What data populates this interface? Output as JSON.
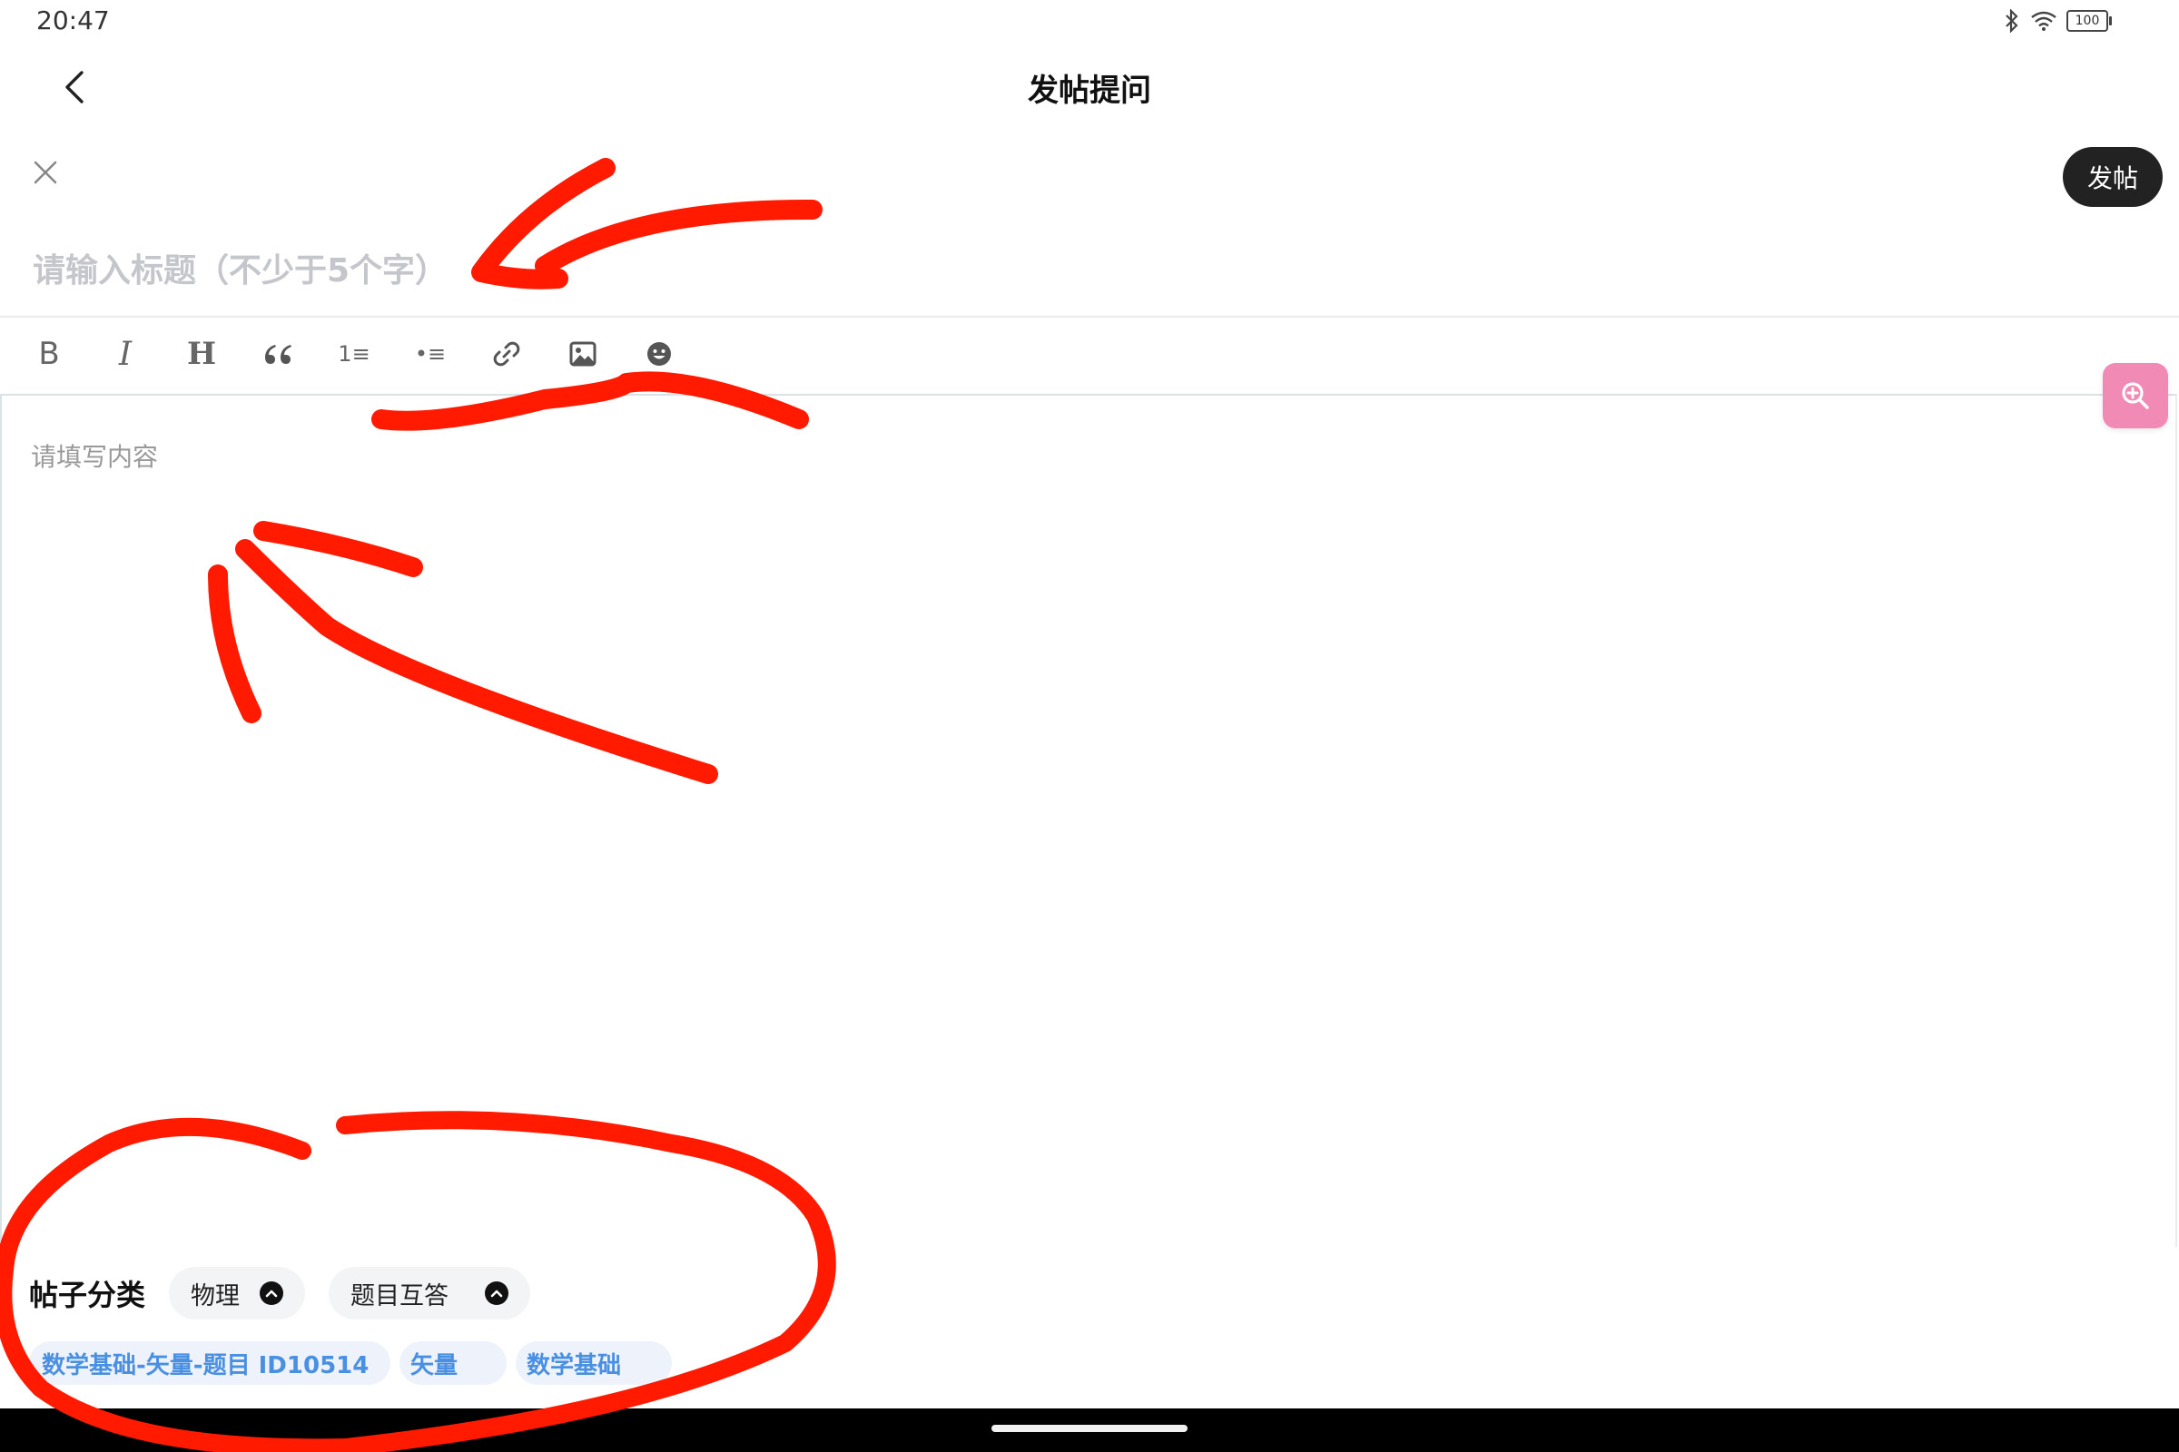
{
  "status_bar": {
    "time": "20:47",
    "battery": "100",
    "icons": [
      "bluetooth-icon",
      "wifi-icon",
      "battery-icon"
    ]
  },
  "nav": {
    "title": "发帖提问",
    "back_icon": "chevron-left-icon"
  },
  "actions": {
    "close_icon": "close-icon",
    "post_label": "发帖"
  },
  "title_field": {
    "placeholder": "请输入标题（不少于5个字）",
    "value": ""
  },
  "toolbar": {
    "bold": "B",
    "italic": "I",
    "heading": "H",
    "quote": "“",
    "ordered_list": "1≡",
    "unordered_list": "•≡",
    "tools": [
      "bold-icon",
      "italic-icon",
      "heading-icon",
      "quote-icon",
      "ordered-list-icon",
      "unordered-list-icon",
      "link-icon",
      "image-icon",
      "emoji-icon"
    ]
  },
  "editor": {
    "placeholder": "请填写内容"
  },
  "zoom": {
    "icon": "zoom-in-icon",
    "color": "#f28ab6"
  },
  "category": {
    "label": "帖子分类",
    "subject": "物理",
    "type": "题目互答"
  },
  "tags": [
    "数学基础-矢量-题目 ID10514",
    "矢量",
    "数学基础"
  ],
  "colors": {
    "annotation": "#ff1a00",
    "tag_text": "#4a90e2",
    "post_button": "#222222"
  }
}
